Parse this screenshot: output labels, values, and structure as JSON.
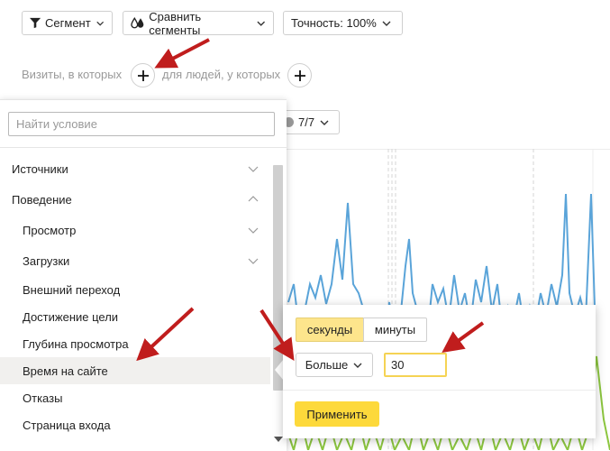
{
  "toolbar": {
    "segment_label": "Сегмент",
    "compare_label": "Сравнить сегменты",
    "accuracy_label": "Точность: 100%"
  },
  "filters": {
    "visits_label": "Визиты, в которых",
    "people_label": "для людей, у которых"
  },
  "period": {
    "label": "7/7"
  },
  "search": {
    "placeholder": "Найти условие"
  },
  "menu": {
    "items": [
      {
        "label": "Источники"
      },
      {
        "label": "Поведение"
      },
      {
        "label": "Просмотр"
      },
      {
        "label": "Загрузки"
      },
      {
        "label": "Внешний переход"
      },
      {
        "label": "Достижение цели"
      },
      {
        "label": "Глубина просмотра"
      },
      {
        "label": "Время на сайте"
      },
      {
        "label": "Отказы"
      },
      {
        "label": "Страница входа"
      }
    ]
  },
  "popup": {
    "unit_seconds": "секунды",
    "unit_minutes": "минуты",
    "comparator": "Больше",
    "value": "30",
    "apply_label": "Применить"
  },
  "colors": {
    "blue_series": "#5aa4d9",
    "green_series": "#8cc63f",
    "accent_yellow": "#fdd93b",
    "annotation_arrow": "#c01d1d"
  }
}
